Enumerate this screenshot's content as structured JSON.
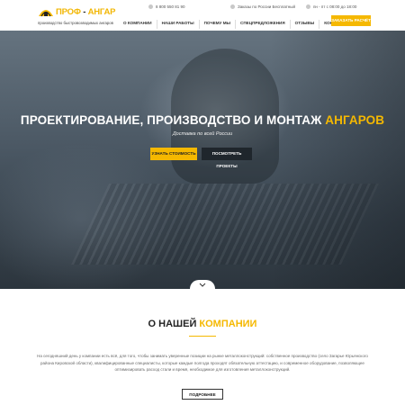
{
  "brand": {
    "name_part1": "ПРОФ",
    "name_dash": " - ",
    "name_part2": "АНГАР",
    "tagline": "производство быстровозводимых ангаров",
    "accent_color": "#f5b800"
  },
  "contacts": {
    "phone": "8 800 550 81 90",
    "region": "Заказы по России Бесплатный",
    "hours": "пн - пт с 08:00 до 18:00"
  },
  "nav": {
    "items": [
      "О КОМПАНИИ",
      "НАШИ РАБОТЫ",
      "ПОЧЕМУ МЫ",
      "СПЕЦПРЕДЛОЖЕНИЯ",
      "ОТЗЫВЫ",
      "КОНТАКТЫ"
    ],
    "cta": "ЗАКАЗАТЬ РАСЧЁТ"
  },
  "hero": {
    "title_main": "ПРОЕКТИРОВАНИЕ, ПРОИЗВОДСТВО И МОНТАЖ ",
    "title_accent": "АНГАРОВ",
    "subtitle": "Доставка по всей России",
    "btn_primary": "УЗНАТЬ СТОИМОСТЬ",
    "btn_secondary": "ПОСМОТРЕТЬ ПРОЕКТЫ",
    "scroll_icon": "chevron-down-icon"
  },
  "about": {
    "title_main": "О НАШЕЙ ",
    "title_accent": "КОМПАНИИ",
    "text": "На сегодняшний день у компании есть всё, для того, чтобы занимать уверенные позиции на рынке металлоконструкций: собственное производство (село Загарье Юрьянского района Кировской области), квалифицированные специалисты, которые каждые полгода проходят обязательную аттестацию, и современное оборудование, позволяющее оптимизировать расход стали и время, необходимое для изготовления металлоконструкций.",
    "more_btn": "ПОДРОБНЕЕ"
  }
}
